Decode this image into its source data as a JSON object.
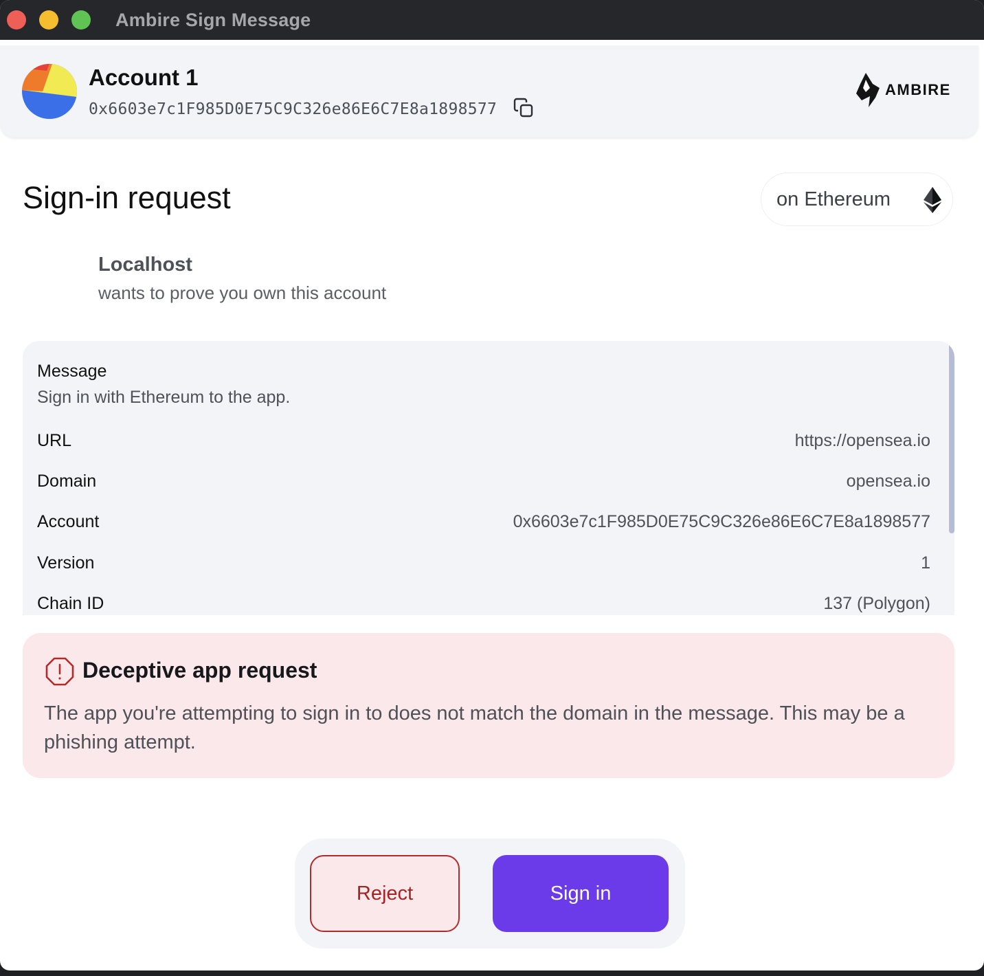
{
  "window": {
    "title": "Ambire Sign Message"
  },
  "account": {
    "name": "Account 1",
    "address": "0x6603e7c1F985D0E75C9C326e86E6C7E8a1898577"
  },
  "brand": {
    "name": "AMBIRE"
  },
  "request": {
    "title": "Sign-in request",
    "network_label": "on Ethereum",
    "dapp_name": "Localhost",
    "dapp_subtitle": "wants to prove you own this account"
  },
  "message": {
    "label": "Message",
    "text": "Sign in with Ethereum to the app.",
    "fields": [
      {
        "label": "URL",
        "value": "https://opensea.io"
      },
      {
        "label": "Domain",
        "value": "opensea.io"
      },
      {
        "label": "Account",
        "value": "0x6603e7c1F985D0E75C9C326e86E6C7E8a1898577"
      },
      {
        "label": "Version",
        "value": "1"
      },
      {
        "label": "Chain ID",
        "value": "137 (Polygon)"
      }
    ]
  },
  "warning": {
    "title": "Deceptive app request",
    "text": "The app you're attempting to sign in to does not match the domain in the message. This may be a phishing attempt."
  },
  "actions": {
    "reject_label": "Reject",
    "sign_label": "Sign in"
  },
  "colors": {
    "primary": "#6b3ae9",
    "danger": "#b42a2a",
    "danger_bg": "#fbe8ea",
    "panel_bg": "#f2f4f8"
  },
  "icons": {
    "copy": "copy-icon",
    "network": "ethereum-icon",
    "warning": "warning-shield-icon",
    "brand": "ambire-logo-icon"
  }
}
